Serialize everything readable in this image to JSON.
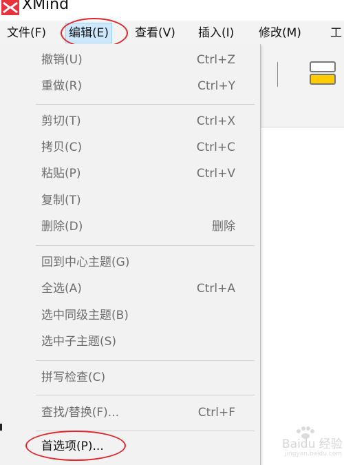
{
  "window": {
    "title": "XMind",
    "logo_icon": "xmind-logo-icon"
  },
  "menubar": {
    "items": [
      {
        "label": "文件(F)",
        "active": false
      },
      {
        "label": "编辑(E)",
        "active": true
      },
      {
        "label": "查看(V)",
        "active": false
      },
      {
        "label": "插入(I)",
        "active": false
      },
      {
        "label": "修改(M)",
        "active": false
      },
      {
        "label": "工",
        "active": false
      }
    ]
  },
  "edit_menu": {
    "groups": [
      [
        {
          "label": "撤销(U)",
          "shortcut": "Ctrl+Z",
          "enabled": false
        },
        {
          "label": "重做(R)",
          "shortcut": "Ctrl+Y",
          "enabled": false
        }
      ],
      [
        {
          "label": "剪切(T)",
          "shortcut": "Ctrl+X",
          "enabled": false
        },
        {
          "label": "拷贝(C)",
          "shortcut": "Ctrl+C",
          "enabled": false
        },
        {
          "label": "粘贴(P)",
          "shortcut": "Ctrl+V",
          "enabled": false
        },
        {
          "label": "复制(T)",
          "shortcut": "",
          "enabled": false
        },
        {
          "label": "删除(D)",
          "shortcut": "删除",
          "enabled": false
        }
      ],
      [
        {
          "label": "回到中心主题(G)",
          "shortcut": "",
          "enabled": false
        },
        {
          "label": "全选(A)",
          "shortcut": "Ctrl+A",
          "enabled": false
        },
        {
          "label": "选中同级主题(B)",
          "shortcut": "",
          "enabled": false
        },
        {
          "label": "选中子主题(S)",
          "shortcut": "",
          "enabled": false
        }
      ],
      [
        {
          "label": "拼写检查(C)",
          "shortcut": "",
          "enabled": false
        }
      ],
      [
        {
          "label": "查找/替换(F)...",
          "shortcut": "Ctrl+F",
          "enabled": false
        }
      ],
      [
        {
          "label": "首选项(P)...",
          "shortcut": "",
          "enabled": true
        }
      ]
    ]
  },
  "watermark": {
    "text": "Baidu 经验",
    "sub": "jingyan.baidu.com"
  },
  "colors": {
    "highlight_circle": "#e0262c",
    "menu_active_bg": "#cde8ff",
    "disabled_text": "#6d6d6d"
  }
}
